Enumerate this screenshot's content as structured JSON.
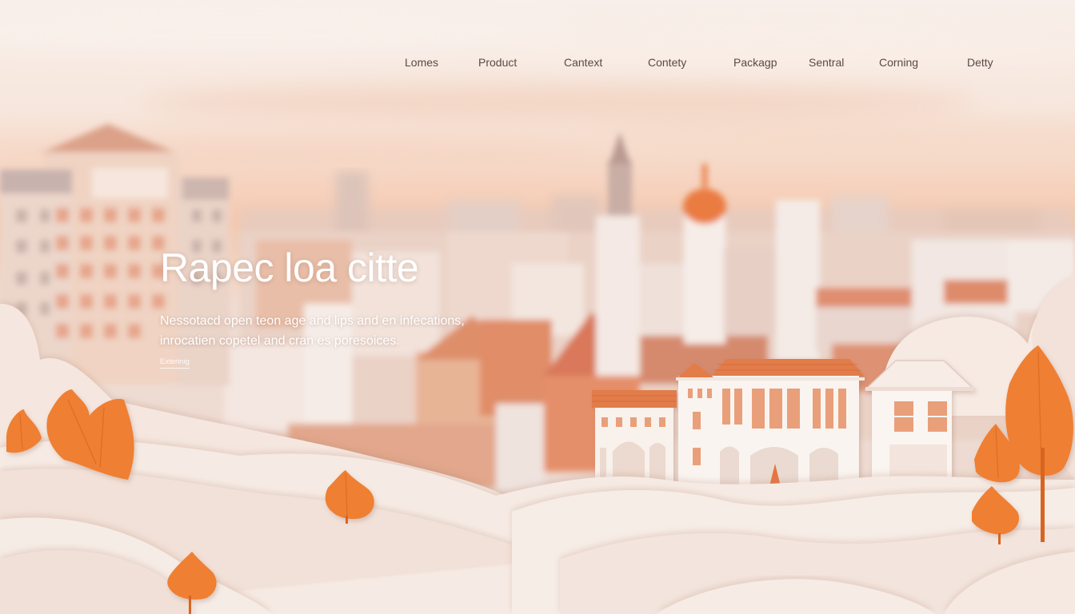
{
  "nav": {
    "items": [
      {
        "label": "Lomes"
      },
      {
        "label": "Product"
      },
      {
        "label": "Cantext"
      },
      {
        "label": "Contety"
      },
      {
        "label": "Packagp"
      },
      {
        "label": "Sentral"
      },
      {
        "label": "Corning"
      },
      {
        "label": "Detty"
      }
    ]
  },
  "hero": {
    "title": "Rapec loa citte",
    "subtitle_lines": [
      "Nessotacd open teon age and lips and en infecations,",
      "inrocatien copetel and cran es poresoices."
    ],
    "link_label": "Exterinig"
  },
  "colors": {
    "sky_top": "#f7ebe4",
    "sky_glow": "#f3c8ac",
    "roof_orange": "#e07a45",
    "leaf_orange": "#ef7f33",
    "paper_hills": "#f4e6dd"
  }
}
